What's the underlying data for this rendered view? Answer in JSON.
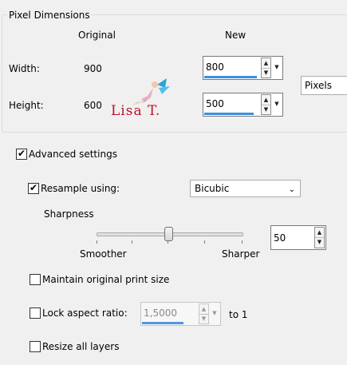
{
  "pixel_dimensions": {
    "title": "Pixel Dimensions",
    "col_original": "Original",
    "col_new": "New",
    "width_label": "Width:",
    "width_original": "900",
    "width_new": "800",
    "height_label": "Height:",
    "height_original": "600",
    "height_new": "500",
    "unit": "Pixels",
    "watermark_text": "Lisa T."
  },
  "advanced": {
    "label": "Advanced settings",
    "checked": true
  },
  "resample": {
    "label": "Resample using:",
    "checked": true,
    "method": "Bicubic"
  },
  "sharpness": {
    "label": "Sharpness",
    "left_label": "Smoother",
    "right_label": "Sharper",
    "value": "50"
  },
  "maintain_print_size": {
    "label": "Maintain original print size",
    "checked": false
  },
  "lock_aspect": {
    "label": "Lock aspect ratio:",
    "checked": false,
    "value": "1,5000",
    "suffix": "to 1"
  },
  "resize_all_layers": {
    "label": "Resize all layers",
    "checked": false
  },
  "colors": {
    "accent": "#3c8fe0",
    "watermark": "#c0102a"
  }
}
